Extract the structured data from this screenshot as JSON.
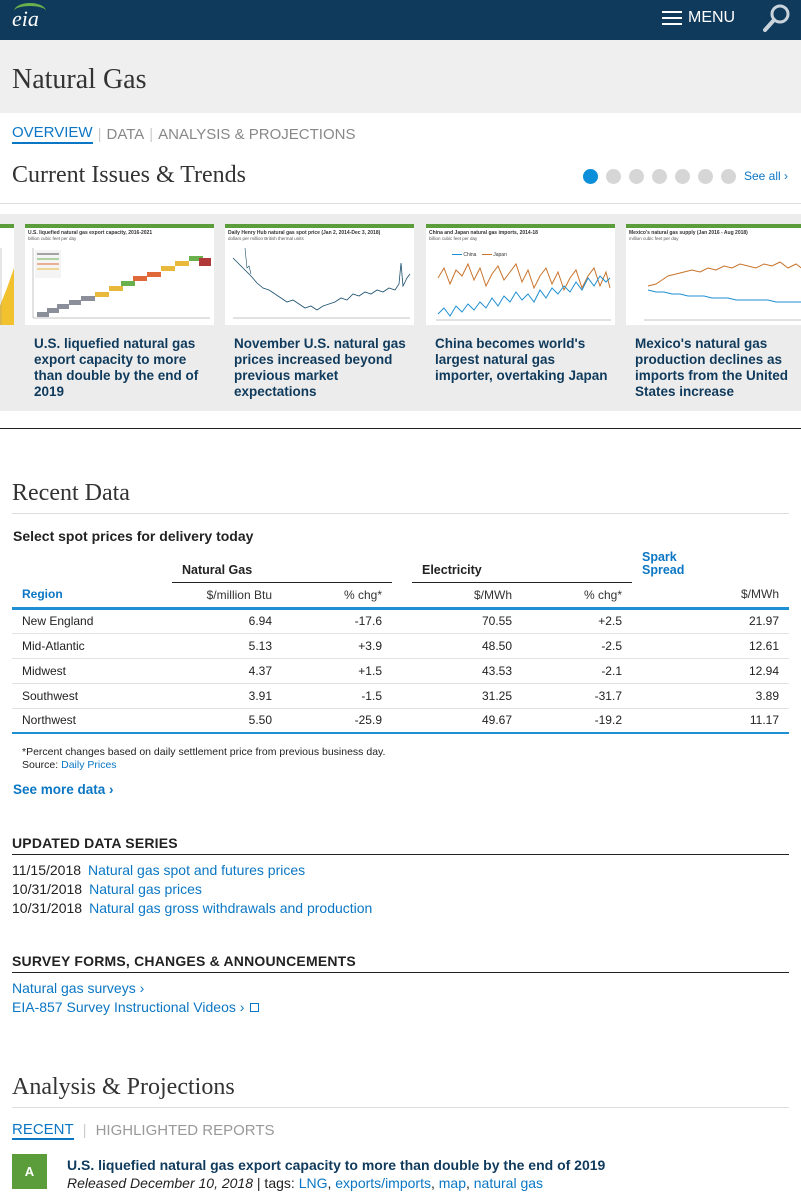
{
  "header": {
    "logo": "eia",
    "menu_label": "MENU"
  },
  "page_title": "Natural Gas",
  "subnav": {
    "overview": "OVERVIEW",
    "data": "DATA",
    "analysis": "ANALYSIS & PROJECTIONS"
  },
  "trends": {
    "heading": "Current Issues & Trends",
    "see_all": "See all ›",
    "dot_count": 7,
    "active_dot": 1,
    "cards": [
      {
        "title": "U.S. liquefied natural gas export capacity to more than double by the end of 2019",
        "chart_title": "U.S. liquefied natural gas export capacity, 2016-2021",
        "chart_sub": "billion cubic feet per day"
      },
      {
        "title": "November U.S. natural gas prices increased beyond previous market expectations",
        "chart_title": "Daily Henry Hub natural gas spot price (Jan 2, 2014-Dec 3, 2018)",
        "chart_sub": "dollars per million British thermal units"
      },
      {
        "title": "China becomes world's largest natural gas importer, overtaking Japan",
        "chart_title": "China and Japan natural gas imports, 2014-18",
        "chart_sub": "billion cubic feet per day",
        "legend": [
          "China",
          "Japan"
        ]
      },
      {
        "title": "Mexico's natural gas production declines as imports from the United States increase",
        "chart_title": "Mexico's natural gas supply (Jan 2016 - Aug 2018)",
        "chart_sub": "million cubic feet per day"
      }
    ]
  },
  "recent_data": {
    "heading": "Recent Data",
    "subheading": "Select spot prices for delivery today",
    "groups": {
      "natural_gas": "Natural Gas",
      "electricity": "Electricity",
      "spark": "Spark Spread"
    },
    "columns": [
      "Region",
      "$/million Btu",
      "% chg*",
      "$/MWh",
      "% chg*",
      "$/MWh"
    ],
    "rows": [
      [
        "New England",
        "6.94",
        "-17.6",
        "70.55",
        "+2.5",
        "21.97"
      ],
      [
        "Mid-Atlantic",
        "5.13",
        "+3.9",
        "48.50",
        "-2.5",
        "12.61"
      ],
      [
        "Midwest",
        "4.37",
        "+1.5",
        "43.53",
        "-2.1",
        "12.94"
      ],
      [
        "Southwest",
        "3.91",
        "-1.5",
        "31.25",
        "-31.7",
        "3.89"
      ],
      [
        "Northwest",
        "5.50",
        "-25.9",
        "49.67",
        "-19.2",
        "11.17"
      ]
    ],
    "note": "*Percent changes based on daily settlement price from previous business day.",
    "source_label": "Source:",
    "source_link": "Daily Prices",
    "see_more": "See more data ›"
  },
  "updated_series": {
    "heading": "UPDATED DATA SERIES",
    "items": [
      {
        "date": "11/15/2018",
        "label": "Natural gas spot and futures prices"
      },
      {
        "date": "10/31/2018",
        "label": "Natural gas prices"
      },
      {
        "date": "10/31/2018",
        "label": "Natural gas gross withdrawals and production"
      }
    ]
  },
  "survey": {
    "heading": "SURVEY FORMS, CHANGES & ANNOUNCEMENTS",
    "links": [
      "Natural gas surveys ›",
      "EIA-857 Survey Instructional Videos ›"
    ]
  },
  "analysis": {
    "heading": "Analysis & Projections",
    "tabs": {
      "recent": "RECENT",
      "highlighted": "HIGHLIGHTED REPORTS"
    },
    "report": {
      "badge": "A",
      "title": "U.S. liquefied natural gas export capacity to more than double by the end of 2019",
      "released": "Released December 10, 2018",
      "tags_label": "| tags:",
      "tags": [
        "LNG",
        "exports/imports",
        "map",
        "natural gas"
      ]
    }
  },
  "colors": {
    "navy": "#0f3a5c",
    "link": "#0b77c4",
    "green": "#5a9d3a",
    "china": "#1d8fd2",
    "japan": "#c8732a"
  }
}
